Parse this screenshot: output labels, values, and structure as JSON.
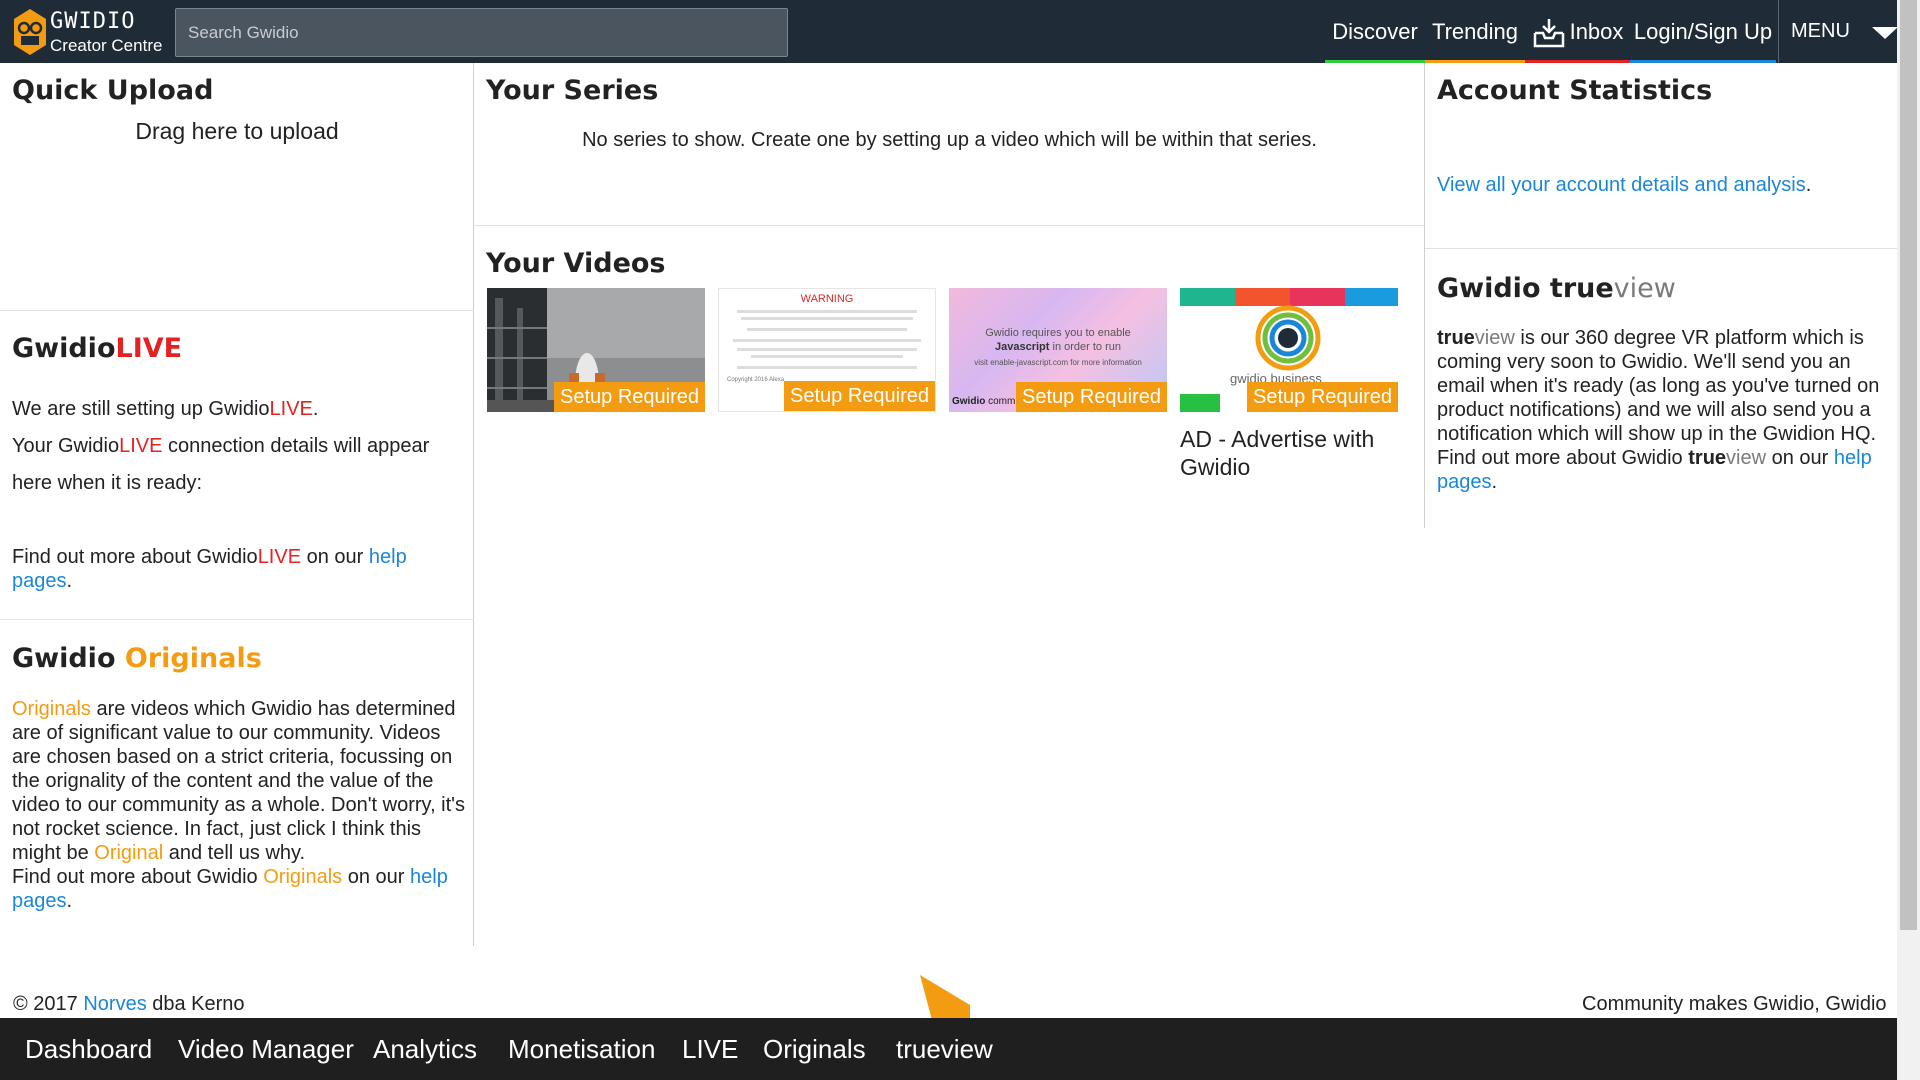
{
  "header": {
    "logo_title": "GWIDIO",
    "logo_subtitle": "Creator Centre",
    "search_placeholder": "Search Gwidio",
    "nav": [
      {
        "label": "Discover",
        "color": "#2ecc40"
      },
      {
        "label": "Trending",
        "color": "#f39c12"
      },
      {
        "label": "Inbox",
        "color": "#e32222"
      },
      {
        "label": "Login/Sign Up",
        "color": "#1a86d8"
      }
    ],
    "menu_label": "MENU"
  },
  "quick_upload": {
    "title": "Quick Upload",
    "drag_text": "Drag here to upload"
  },
  "live": {
    "title_prefix": "Gwidio",
    "title_suffix": "LIVE",
    "line1_prefix": "We are still setting up Gwidio",
    "line1_suffix": "LIVE",
    "line1_end": ".",
    "line2_prefix": "Your Gwidio",
    "line2_live": "LIVE",
    "line2_suffix": " connection details will appear here when it is ready:",
    "more_prefix": "Find out more about Gwidio",
    "more_live": "LIVE",
    "more_mid": " on our ",
    "more_link": "help pages",
    "more_end": "."
  },
  "originals": {
    "title_prefix": "Gwidio ",
    "title_suffix": "Originals",
    "p_originals": "Originals",
    "p_text1": " are videos which Gwidio has determined are of significant value to our community. Videos are chosen based on a strict criteria, focussing on the orignality of the content and the value of the video to our community as a whole. Don't worry, it's not rocket science. In fact, just click I think this might be ",
    "p_original": "Original",
    "p_text2": " and tell us why.",
    "more_prefix": "Find out more about Gwidio ",
    "more_originals": "Originals",
    "more_mid": " on our ",
    "more_link": "help pages",
    "more_end": "."
  },
  "series": {
    "title": "Your Series",
    "empty_text": "No series to show. Create one by setting up a video which will be within that series."
  },
  "videos": {
    "title": "Your Videos",
    "items": [
      {
        "badge": "Setup Required",
        "caption": ""
      },
      {
        "badge": "Setup Required",
        "caption": "",
        "warning_title": "WARNING",
        "copyright": "Copyright 2016 Alexa"
      },
      {
        "badge": "Setup Required",
        "caption": "",
        "js_line1": "Gwidio requires you to enable",
        "js_bold": "Javascript",
        "js_line2": " in order to run",
        "js_visit": "visit enable-javascript.com for more information",
        "js_brand": "Gwidio",
        "js_brand2": "comm"
      },
      {
        "badge": "Setup Required",
        "caption": "AD - Advertise with Gwidio",
        "thumb_text": "gwidio business"
      }
    ]
  },
  "account": {
    "title": "Account Statistics",
    "link_text": "View all your account details and analysis",
    "link_end": "."
  },
  "trueview": {
    "title_prefix": "Gwidio ",
    "title_true": "true",
    "title_view": "view",
    "p_true": "true",
    "p_view": "view",
    "p_text": " is our 360 degree VR platform which is coming very soon to Gwidio. We'll send you an email when it's ready (as long as you've turned on product notifications) and we will also send you a notification which will show up in the Gwidion HQ.",
    "more_prefix": "Find out more about Gwidio ",
    "more_true": "true",
    "more_view": "view",
    "more_mid": " on our ",
    "more_link": "help pages",
    "more_end": "."
  },
  "footer": {
    "copyright_prefix": "© 2017 ",
    "norves": "Norves",
    "copyright_suffix": " dba Kerno",
    "tagline": "Community makes Gwidio, Gwidio"
  },
  "bottom_nav": [
    "Dashboard",
    "Video Manager",
    "Analytics",
    "Monetisation",
    "LIVE",
    "Originals",
    "trueview"
  ],
  "colors": {
    "topbar": "#1f2c38",
    "accent_orange": "#f39c12",
    "live_red": "#e32222",
    "link_blue": "#1a86d8",
    "bottombar": "#1f1f1f"
  }
}
